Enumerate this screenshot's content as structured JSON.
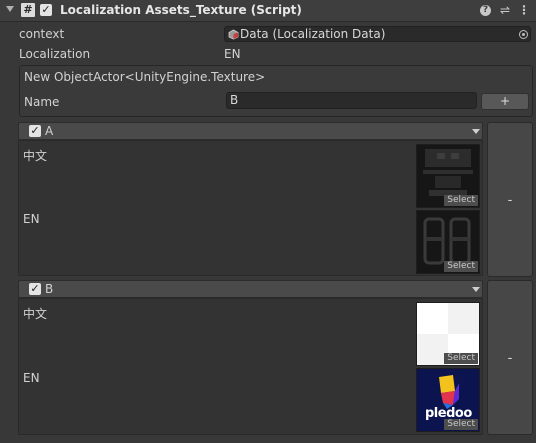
{
  "header": {
    "title": "Localization Assets_Texture (Script)",
    "script_glyph": "#"
  },
  "fields": {
    "context_label": "context",
    "context_value": "Data (Localization Data)",
    "localization_label": "Localization",
    "localization_value": "EN"
  },
  "new_entry": {
    "type_label": "New ObjectActor<UnityEngine.Texture>",
    "name_label": "Name",
    "name_value": "B",
    "add_label": "+"
  },
  "groups": [
    {
      "name": "A",
      "remove_label": "-",
      "entries": [
        {
          "lang": "中文",
          "select_label": "Select"
        },
        {
          "lang": "EN",
          "select_label": "Select"
        }
      ]
    },
    {
      "name": "B",
      "remove_label": "-",
      "entries": [
        {
          "lang": "中文",
          "select_label": "Select"
        },
        {
          "lang": "EN",
          "select_label": "Select",
          "logo_text": "pledoo"
        }
      ]
    }
  ],
  "icons": {
    "foldout": "foldout-arrow-icon",
    "script": "script-icon",
    "enabled": "checkbox-icon",
    "help": "help-icon",
    "presets": "presets-icon",
    "menu": "kebab-menu-icon",
    "object_picker": "object-picker-icon"
  },
  "colors": {
    "background": "#383838",
    "panel": "#333333",
    "field": "#2a2a2a",
    "text": "#d2d2d2"
  }
}
